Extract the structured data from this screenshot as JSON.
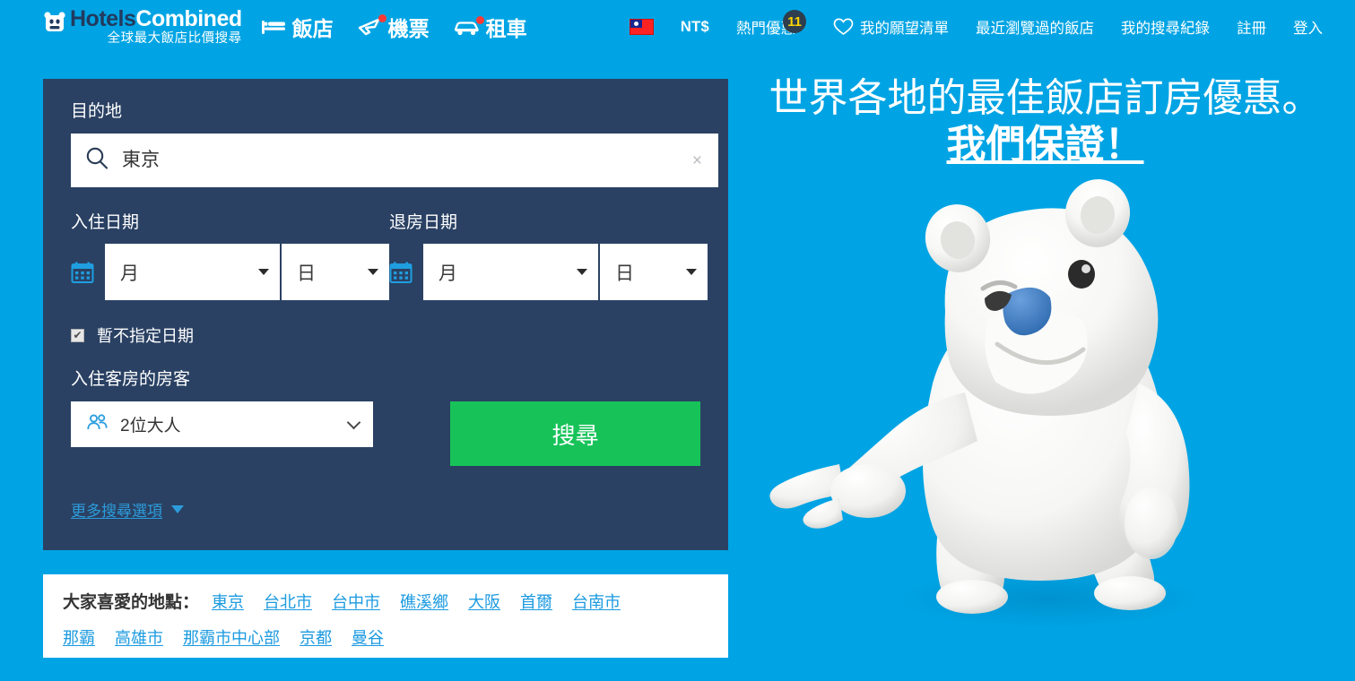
{
  "brand": {
    "name_part1": "Hotels",
    "name_part2": "Combined",
    "tagline": "全球最大飯店比價搜尋",
    "logo_icon": "bear-logo-icon"
  },
  "nav": {
    "main": [
      {
        "label": "飯店",
        "icon": "bed-icon",
        "dot": false
      },
      {
        "label": "機票",
        "icon": "plane-icon",
        "dot": true
      },
      {
        "label": "租車",
        "icon": "car-icon",
        "dot": true
      }
    ],
    "right": {
      "flag_icon": "taiwan-flag-icon",
      "currency": "NT$",
      "deals_label": "熱門優惠",
      "deals_badge": "11",
      "wishlist_label": "我的願望清單",
      "wishlist_icon": "heart-icon",
      "recent_label": "最近瀏覽過的飯店",
      "history_label": "我的搜尋紀錄",
      "register_label": "註冊",
      "login_label": "登入"
    }
  },
  "search": {
    "destination_label": "目的地",
    "destination_value": "東京",
    "destination_placeholder": "目的地",
    "search_icon": "search-icon",
    "clear_icon": "×",
    "checkin_label": "入住日期",
    "checkout_label": "退房日期",
    "calendar_icon": "calendar-icon",
    "checkin_month": "月",
    "checkin_day": "日",
    "checkout_month": "月",
    "checkout_day": "日",
    "nodate_label": "暫不指定日期",
    "nodate_checked": "✔",
    "guests_label": "入住客房的房客",
    "guests_value": "2位大人",
    "guests_icon": "people-icon",
    "search_button": "搜尋",
    "more_options": "更多搜尋選項",
    "more_options_caret": "▼"
  },
  "popular": {
    "title": "大家喜愛的地點：",
    "row1": [
      "東京",
      "台北市",
      "台中市",
      "礁溪鄉",
      "大阪",
      "首爾",
      "台南市"
    ],
    "row2": [
      "那霸",
      "高雄市",
      "那霸市中心部",
      "京都",
      "曼谷"
    ]
  },
  "hero": {
    "headline_normal": "世界各地的最佳飯店訂房優惠。",
    "headline_bold": "我們保證！",
    "mascot": "polar-bear-mascot"
  },
  "colors": {
    "page_blue": "#00a4e4",
    "panel_navy": "#2a4163",
    "search_green": "#17c359",
    "link_blue": "#1b9ae0",
    "badge_bg": "#2e3e4e",
    "badge_text": "#ffd400",
    "dot_red": "#fc3a35"
  }
}
